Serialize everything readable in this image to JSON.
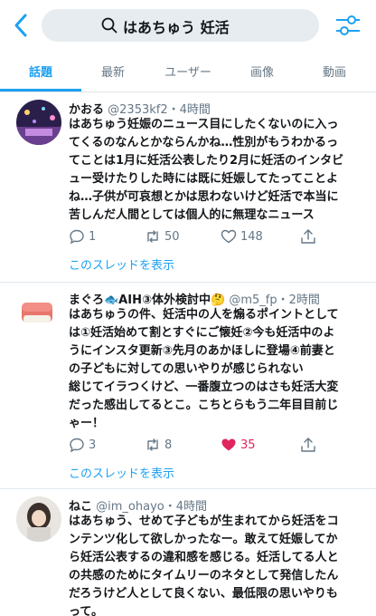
{
  "search": {
    "query": "はあちゅう 妊活"
  },
  "tabs": [
    "話題",
    "最新",
    "ユーザー",
    "画像",
    "動画"
  ],
  "colors": {
    "accent": "#1da1f2",
    "like_active": "#e0245e",
    "muted": "#657786"
  },
  "icons": {
    "back": "chevron-left-icon",
    "search": "search-icon",
    "filter": "filter-sliders-icon",
    "reply": "reply-icon",
    "retweet": "retweet-icon",
    "like": "heart-icon",
    "share": "share-icon"
  },
  "tweets": [
    {
      "name": "かおる",
      "meta": "@2353kf2・4時間",
      "lines": [
        "はあちゅう妊娠のニュース目にしたくないのに入っ",
        "てくるのなんとかならんかね…性別がもうわかるっ",
        "てことは1月に妊活公表したり2月に妊活のインタビ",
        "ュー受けたりした時には既に妊娠してたってことよ",
        "ね…子供が可哀想とかは思わないけど妊活で本当に",
        "苦しんだ人間としては個人的に無理なニュース"
      ],
      "replies": "1",
      "retweets": "50",
      "likes": "148",
      "liked": false,
      "thread_link": "このスレッドを表示"
    },
    {
      "name": "まぐろ🐟AIH③体外検討中🤔",
      "meta": "@m5_fp・2時間",
      "lines": [
        "はあちゅうの件、妊活中の人を煽るポイントとして",
        "は①妊活始めて割とすぐにご懐妊②今も妊活中のよ",
        "うにインスタ更新③先月のあかほしに登場④前妻と",
        "の子どもに対しての思いやりが感じられない",
        "総じてイラつくけど、一番腹立つのはさも妊活大変",
        "だった感出してるとこ。こちとらもう二年目目前じ",
        "ゃー！"
      ],
      "replies": "3",
      "retweets": "8",
      "likes": "35",
      "liked": true,
      "thread_link": "このスレッドを表示"
    },
    {
      "name": "ねこ",
      "meta": "@im_ohayo・4時間",
      "lines": [
        "はあちゅう、せめて子どもが生まれてから妊活をコ",
        "ンテンツ化して欲しかったなー。敢えて妊娠してか",
        "ら妊活公表するの違和感を感じる。妊活してる人と",
        "の共感のためにタイムリーのネタとして発信したん",
        "だろうけど人として良くない、最低限の思いやりも",
        "って。"
      ]
    }
  ]
}
